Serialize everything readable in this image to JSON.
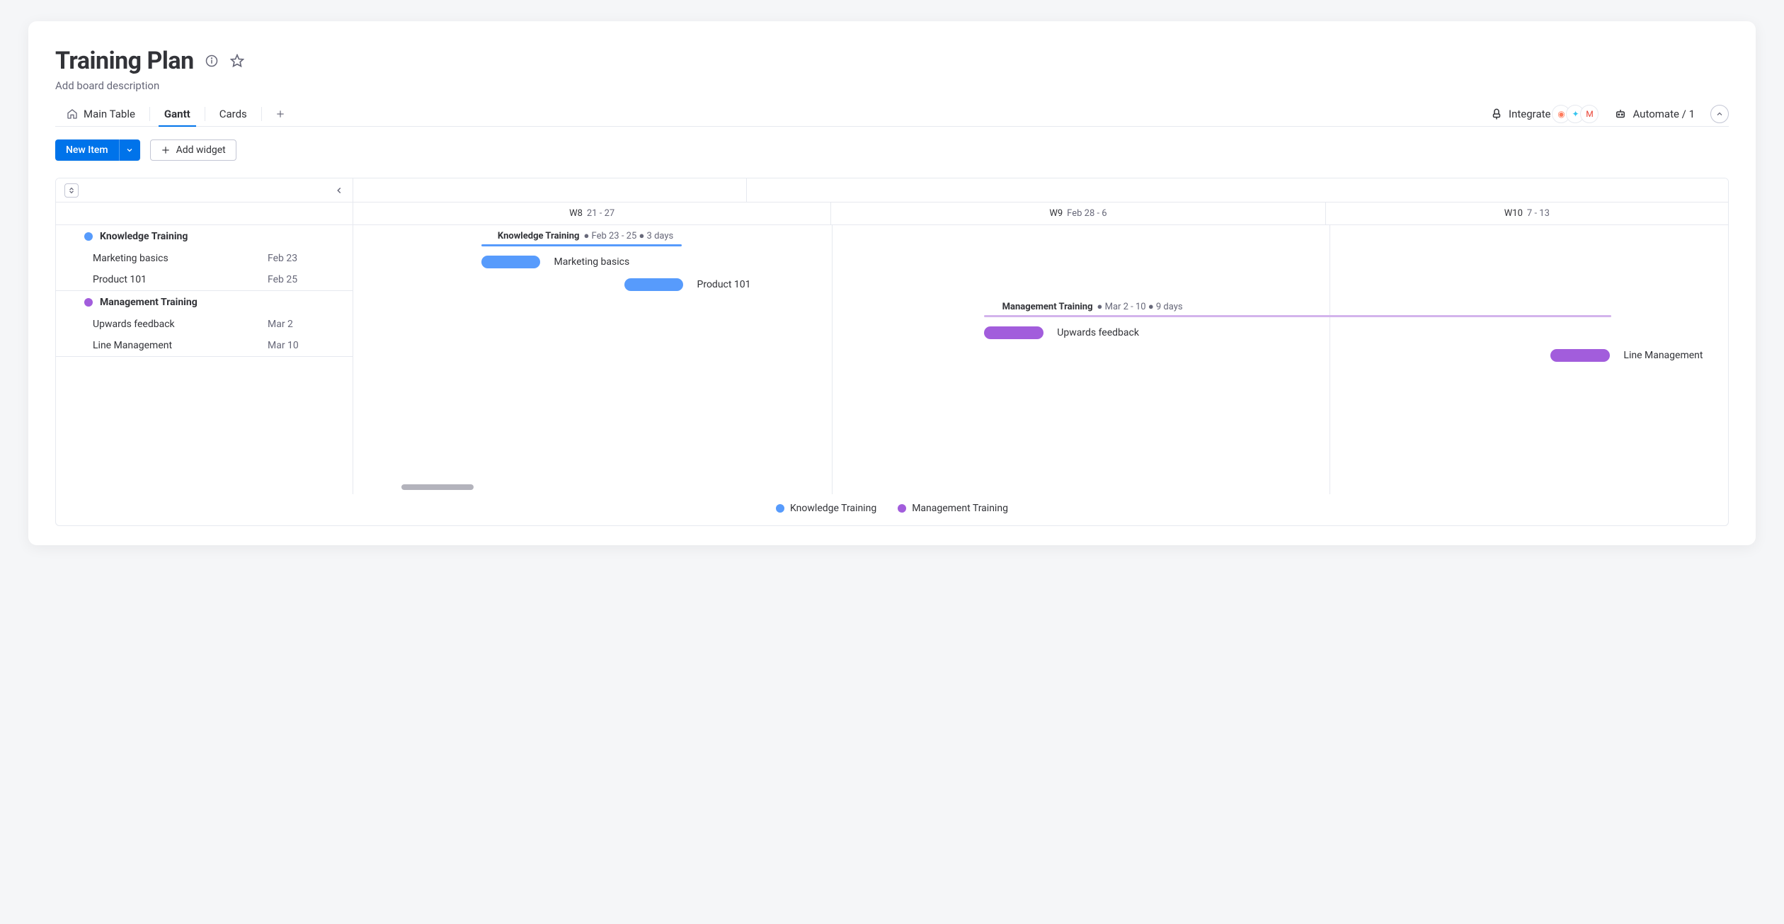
{
  "header": {
    "title": "Training Plan",
    "description": "Add board description"
  },
  "tabs": {
    "main_table": "Main Table",
    "gantt": "Gantt",
    "cards": "Cards"
  },
  "actions": {
    "integrate": "Integrate",
    "automate": "Automate / 1",
    "new_item": "New Item",
    "add_widget": "Add widget"
  },
  "colors": {
    "blue": "#579bfc",
    "purple": "#a25ddc"
  },
  "timeline": {
    "weeks": [
      {
        "wk": "W8",
        "range": "21 - 27"
      },
      {
        "wk": "W9",
        "range": "Feb 28 - 6"
      },
      {
        "wk": "W10",
        "range": "7 - 13"
      }
    ]
  },
  "groups": [
    {
      "name": "Knowledge Training",
      "color": "#579bfc",
      "summary_range": "Feb 23 - 25",
      "summary_days": "3 days",
      "line": {
        "left_pct": 9.3,
        "width_pct": 14.6
      },
      "label_left_pct": 10.5,
      "items": [
        {
          "name": "Marketing basics",
          "date": "Feb 23",
          "bar": {
            "left_pct": 9.3,
            "width_pct": 4.3
          }
        },
        {
          "name": "Product 101",
          "date": "Feb 25",
          "bar": {
            "left_pct": 19.7,
            "width_pct": 4.3
          }
        }
      ]
    },
    {
      "name": "Management Training",
      "color": "#a25ddc",
      "line_color": "#d3b4ec",
      "summary_range": "Mar 2 - 10",
      "summary_days": "9 days",
      "line": {
        "left_pct": 45.9,
        "width_pct": 45.6
      },
      "label_left_pct": 47.2,
      "items": [
        {
          "name": "Upwards feedback",
          "date": "Mar 2",
          "bar": {
            "left_pct": 45.9,
            "width_pct": 4.3
          }
        },
        {
          "name": "Line Management",
          "date": "Mar 10",
          "bar": {
            "left_pct": 87.1,
            "width_pct": 4.3
          }
        }
      ]
    }
  ],
  "legend": [
    {
      "label": "Knowledge Training",
      "color": "#579bfc"
    },
    {
      "label": "Management Training",
      "color": "#a25ddc"
    }
  ]
}
